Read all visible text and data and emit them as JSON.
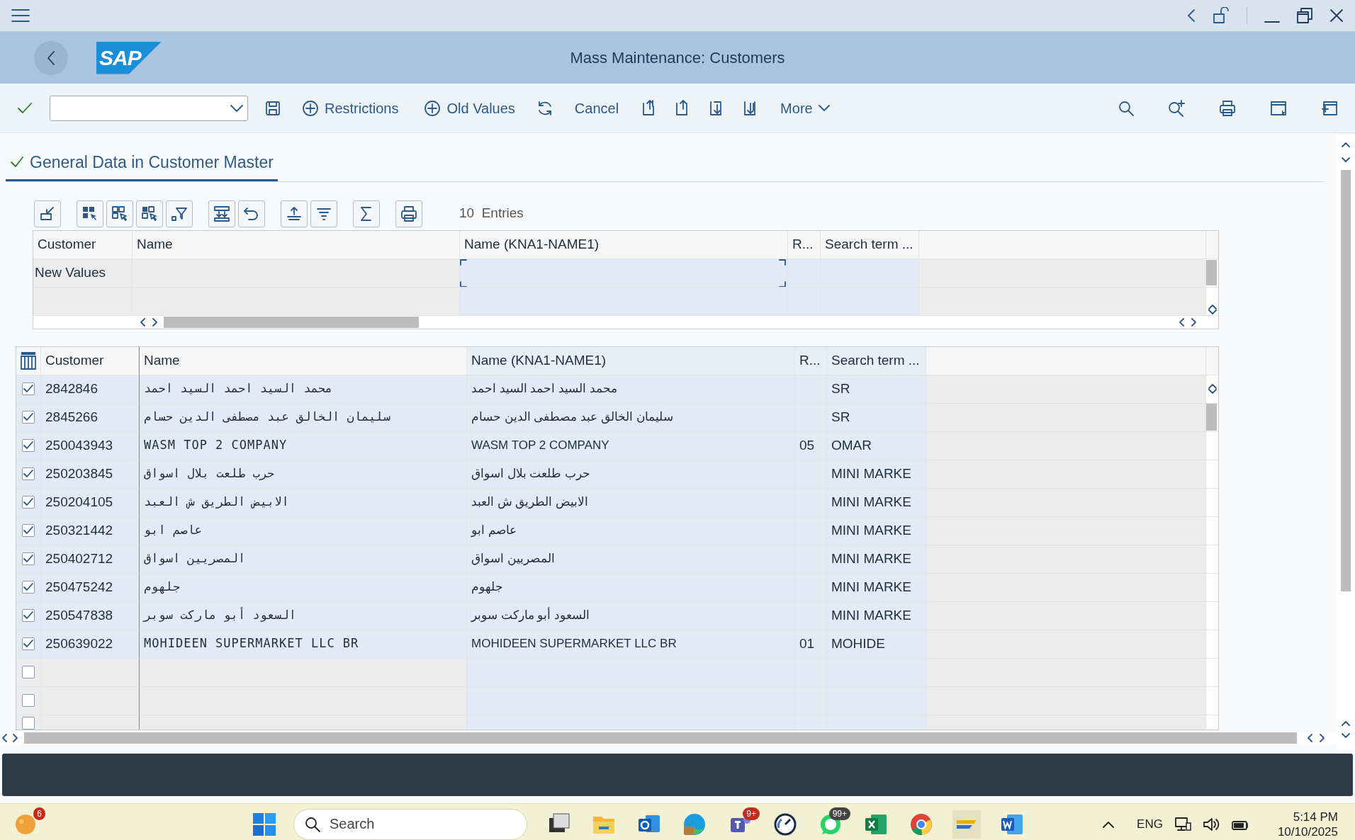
{
  "window": {
    "title": "Mass Maintenance: Customers",
    "logo": "SAP"
  },
  "toolbar": {
    "buttons": [
      {
        "label": "Restrictions",
        "kind": "add"
      },
      {
        "label": "Old Values",
        "kind": "add"
      },
      {
        "label": "Cancel",
        "kind": "plain"
      },
      {
        "label": "More",
        "kind": "menu"
      }
    ]
  },
  "section": {
    "title": "General Data in Customer Master",
    "checked": true
  },
  "alv_toolbar": {
    "count": "10",
    "count_label": "Entries"
  },
  "upper_grid": {
    "columns": [
      {
        "label": "Customer",
        "editable": false,
        "focused": false
      },
      {
        "label": "Name",
        "editable": false,
        "focused": false
      },
      {
        "label": "Name (KNA1-NAME1)",
        "editable": true,
        "focused": true
      },
      {
        "label": "R...",
        "editable": true,
        "focused": false
      },
      {
        "label": "Search term ...",
        "editable": true,
        "focused": false
      }
    ],
    "row_label": "New Values"
  },
  "lower_grid": {
    "columns": [
      {
        "label": "Customer",
        "editable": false
      },
      {
        "label": "Name",
        "editable": false
      },
      {
        "label": "Name (KNA1-NAME1)",
        "editable": true
      },
      {
        "label": "R...",
        "editable": true
      },
      {
        "label": "Search term ...",
        "editable": true
      }
    ],
    "rows": [
      {
        "checked": true,
        "cells": [
          "2842846",
          "محمد السيد احمد السيد احمد",
          "محمد السيد احمد السيد احمد",
          "",
          "SR"
        ]
      },
      {
        "checked": true,
        "cells": [
          "2845266",
          "سليمان الخالق عبد مصطفى الدين حسام",
          "سليمان الخالق عبد مصطفى الدين حسام",
          "",
          "SR"
        ]
      },
      {
        "checked": true,
        "cells": [
          "250043943",
          "WASM TOP 2 COMPANY",
          "WASM TOP 2 COMPANY",
          "05",
          "OMAR"
        ]
      },
      {
        "checked": true,
        "cells": [
          "250203845",
          "حرب طلعت  بلال اسواق",
          "حرب طلعت  بلال اسواق",
          "",
          "MINI MARKE"
        ]
      },
      {
        "checked": true,
        "cells": [
          "250204105",
          "الابيض الطريق ش  العبد",
          "الابيض الطريق ش العبد",
          "",
          "MINI MARKE"
        ]
      },
      {
        "checked": true,
        "cells": [
          "250321442",
          "عاصم ابو",
          "عاصم ابو",
          "",
          "MINI MARKE"
        ]
      },
      {
        "checked": true,
        "cells": [
          "250402712",
          "المصريين اسواق",
          "المصريين اسواق",
          "",
          "MINI MARKE"
        ]
      },
      {
        "checked": true,
        "cells": [
          "250475242",
          "جلهوم",
          "جلهوم",
          "",
          "MINI MARKE"
        ]
      },
      {
        "checked": true,
        "cells": [
          "250547838",
          "السعود أبو ماركت سوبر",
          "السعود أبو ماركت سوبر",
          "",
          "MINI MARKE"
        ]
      },
      {
        "checked": true,
        "cells": [
          "250639022",
          "MOHIDEEN SUPERMARKET LLC BR",
          "MOHIDEEN SUPERMARKET LLC BR",
          "01",
          "MOHIDE"
        ]
      },
      {
        "checked": false,
        "cells": []
      },
      {
        "checked": false,
        "cells": []
      },
      {
        "checked": false,
        "cells": []
      }
    ]
  },
  "taskbar": {
    "search": {
      "placeholder": "Search"
    },
    "badges": [
      "6",
      "9+",
      "99+"
    ],
    "language": "ENG",
    "time": "5:14 PM",
    "date": "10/10/2025"
  }
}
